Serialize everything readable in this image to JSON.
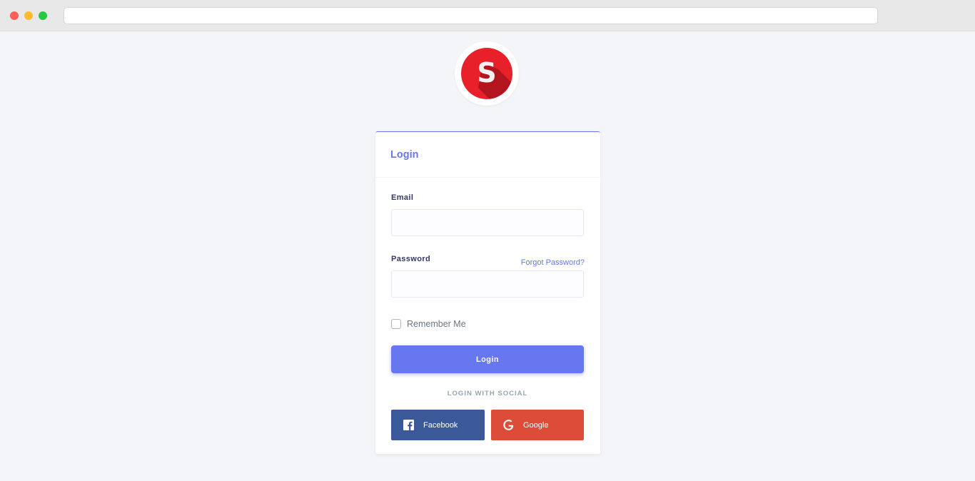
{
  "browser": {
    "address": ""
  },
  "logo": {
    "letter": "S",
    "brand_color": "#e8202a",
    "shadow_color": "#b2151d"
  },
  "login_card": {
    "title": "Login",
    "accent_color": "#6777ef",
    "email": {
      "label": "Email",
      "value": "",
      "placeholder": ""
    },
    "password": {
      "label": "Password",
      "value": "",
      "placeholder": "",
      "forgot_link": "Forgot Password?"
    },
    "remember_me": {
      "label": "Remember Me",
      "checked": false
    },
    "submit_label": "Login",
    "social_heading": "LOGIN WITH SOCIAL",
    "social_buttons": [
      {
        "label": "Facebook",
        "icon": "facebook-icon",
        "color": "#3b5998"
      },
      {
        "label": "Google",
        "icon": "google-icon",
        "color": "#dd4b39"
      }
    ]
  }
}
